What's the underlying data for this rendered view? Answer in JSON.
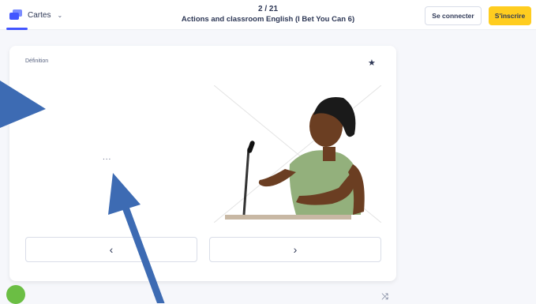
{
  "header": {
    "mode_label": "Cartes",
    "progress": "2 / 21",
    "set_title": "Actions and classroom English (I Bet You Can 6)",
    "login_label": "Se connecter",
    "signup_label": "S'inscrire"
  },
  "card": {
    "side_label": "Définition",
    "term_placeholder": "...",
    "prev_symbol": "‹",
    "next_symbol": "›"
  },
  "colors": {
    "accent": "#4255ff",
    "signup": "#ffcd1f",
    "annotation_arrow": "#3d6bb3"
  },
  "icons": [
    "cards-icon",
    "chevron-down-icon",
    "star-icon",
    "chevron-left-icon",
    "chevron-right-icon",
    "shuffle-icon",
    "cookie-icon"
  ]
}
